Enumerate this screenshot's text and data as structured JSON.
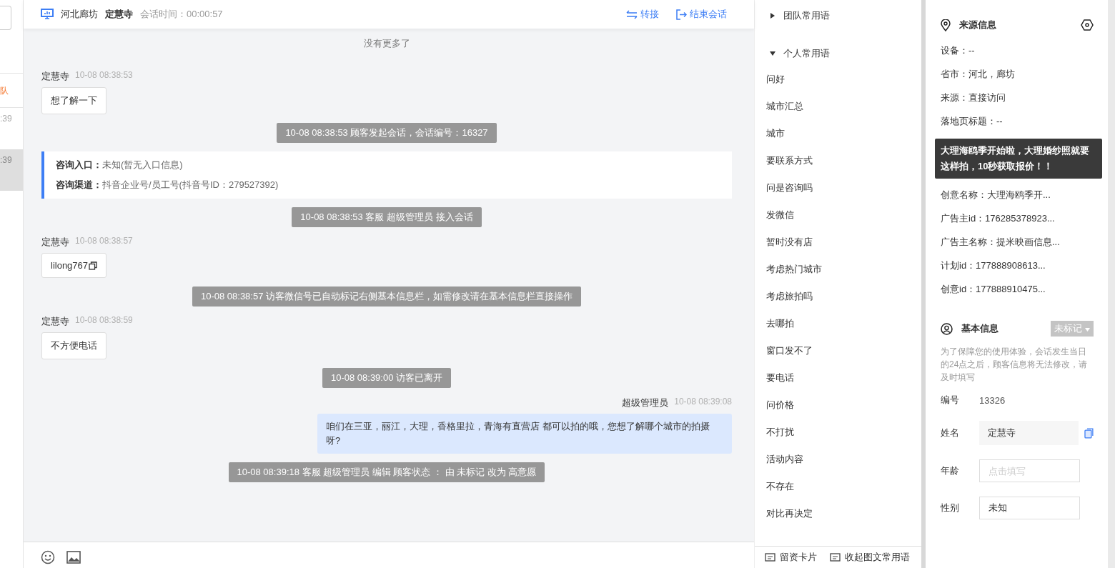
{
  "left_strip": {
    "items": [
      {
        "text": "队",
        "kind": "alert"
      },
      {
        "text": ":39",
        "kind": "time",
        "selected": false
      },
      {
        "text": ":39",
        "kind": "time",
        "selected": true
      }
    ]
  },
  "header": {
    "location": "河北廊坊",
    "visitor": "定慧寺",
    "duration": "会话时间：00:00:57",
    "actions": [
      "转接",
      "结束会话"
    ]
  },
  "chat": {
    "notice": "没有更多了",
    "messages": [
      {
        "kind": "visitor",
        "sender": "定慧寺",
        "time": "10-08 08:38:53",
        "text": "想了解一下",
        "copyable": false
      },
      {
        "kind": "system",
        "text": "10-08 08:38:53 顾客发起会话，会话编号：16327"
      },
      {
        "kind": "card",
        "rows": [
          {
            "label": "咨询入口：",
            "value": "未知(暂无入口信息)"
          },
          {
            "label": "咨询渠道：",
            "value": "抖音企业号/员工号(抖音号ID：279527392)"
          }
        ]
      },
      {
        "kind": "system",
        "text": "10-08 08:38:53 客服 超级管理员 接入会话"
      },
      {
        "kind": "visitor",
        "sender": "定慧寺",
        "time": "10-08 08:38:57",
        "text": "lilong767",
        "copyable": true
      },
      {
        "kind": "system",
        "text": "10-08 08:38:57 访客微信号已自动标记右侧基本信息栏，如需修改请在基本信息栏直接操作"
      },
      {
        "kind": "visitor",
        "sender": "定慧寺",
        "time": "10-08 08:38:59",
        "text": "不方便电话",
        "copyable": false
      },
      {
        "kind": "system",
        "text": "10-08 08:39:00 访客已离开"
      },
      {
        "kind": "agent",
        "sender": "超级管理员",
        "time": "10-08 08:39:08",
        "text": "咱们在三亚，丽江，大理，香格里拉，青海有直营店 都可以拍的哦，您想了解哪个城市的拍摄呀?"
      },
      {
        "kind": "system",
        "text": "10-08 08:39:18 客服 超级管理员 编辑 顾客状态 ： 由 未标记 改为 高意愿"
      }
    ]
  },
  "phrases": {
    "groups": [
      {
        "label": "团队常用语",
        "expanded": false
      },
      {
        "label": "个人常用语",
        "expanded": true,
        "children": [
          {
            "label": "问好"
          },
          {
            "label": "城市汇总"
          },
          {
            "label": "城市"
          },
          {
            "label": "要联系方式"
          },
          {
            "label": "问是咨询吗"
          },
          {
            "label": "发微信"
          },
          {
            "label": "暂时没有店"
          },
          {
            "label": "考虑热门城市"
          },
          {
            "label": "考虑旅拍吗"
          },
          {
            "label": "去哪拍"
          },
          {
            "label": "窗口发不了"
          },
          {
            "label": "要电话"
          },
          {
            "label": "问价格"
          },
          {
            "label": "不打扰"
          },
          {
            "label": "活动内容"
          },
          {
            "label": "不存在"
          },
          {
            "label": "对比再决定"
          }
        ]
      }
    ]
  },
  "footer": {
    "actions": [
      "留资卡片",
      "收起图文常用语"
    ]
  },
  "source_info": {
    "title": "来源信息",
    "rows_top": [
      "设备：--",
      "省市：河北，廊坊",
      "来源：直接访问",
      "落地页标题：--"
    ],
    "tooltip": "大理海鸥季开始啦，大理婚纱照就要这样拍，10秒获取报价！！",
    "rows_bottom": [
      "创意名称：大理海鸥季开...",
      "广告主id：176285378923...",
      "广告主名称：提米映画信息...",
      "计划id：177888908613...",
      "创意id：177888910475..."
    ]
  },
  "basic_info": {
    "title": "基本信息",
    "status": "未标记",
    "note": "为了保障您的使用体验，会话发生当日的24点之后，顾客信息将无法修改，请及时填写",
    "fields": [
      {
        "kind": "static",
        "label": "编号",
        "value": "13326"
      },
      {
        "kind": "readonly",
        "label": "姓名",
        "value": "定慧寺"
      },
      {
        "kind": "input",
        "label": "年龄",
        "placeholder": "点击填写"
      },
      {
        "kind": "input",
        "label": "性别",
        "value": "未知"
      }
    ]
  }
}
